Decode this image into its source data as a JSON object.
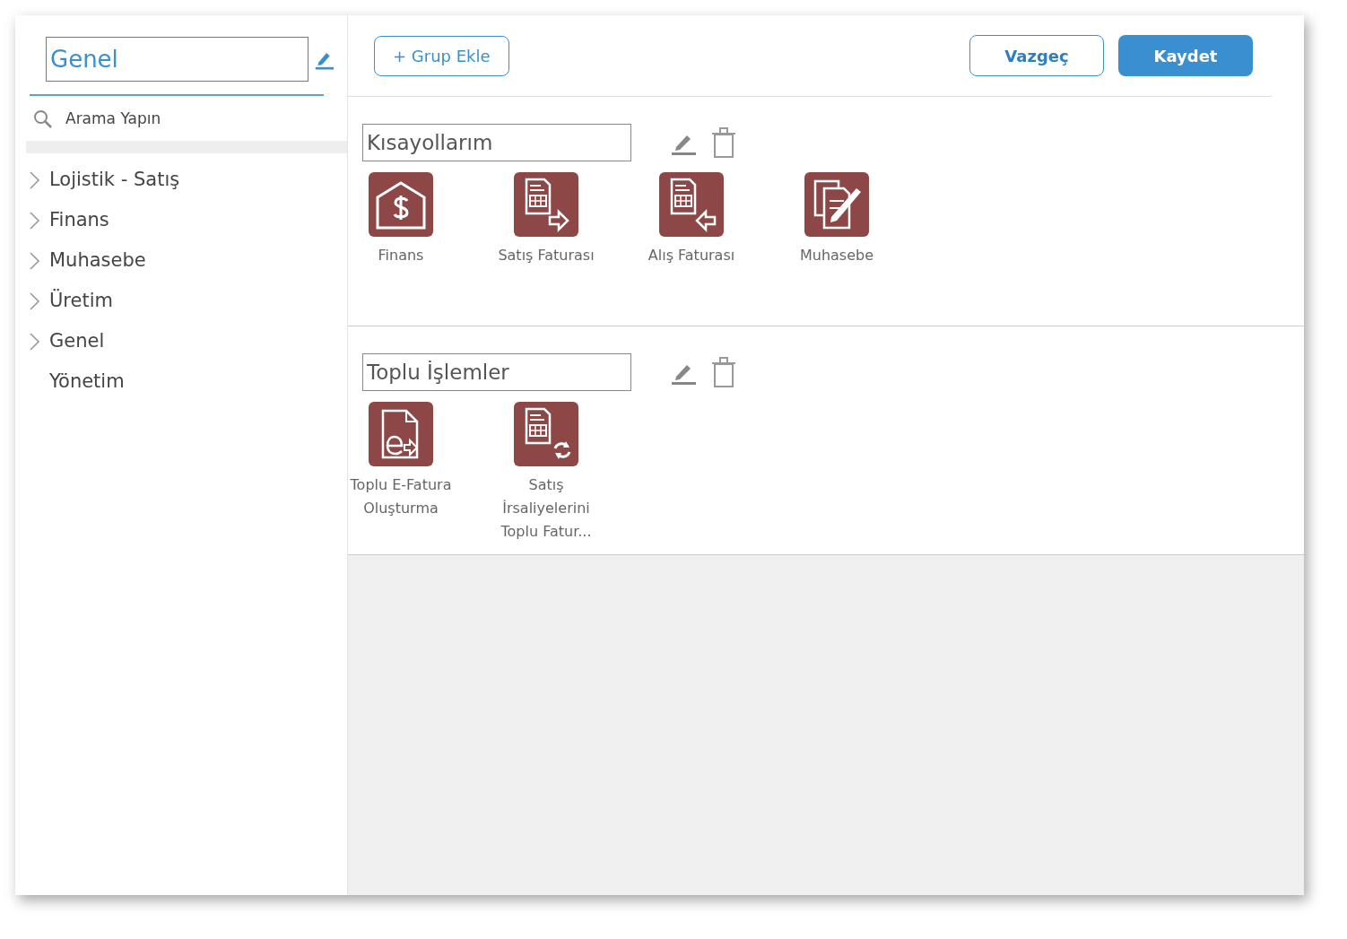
{
  "sidebar": {
    "title": "Genel",
    "search": {
      "placeholder": "Arama Yapın"
    },
    "items": [
      {
        "label": "Lojistik - Satış",
        "expandable": true
      },
      {
        "label": "Finans",
        "expandable": true
      },
      {
        "label": "Muhasebe",
        "expandable": true
      },
      {
        "label": "Üretim",
        "expandable": true
      },
      {
        "label": "Genel",
        "expandable": true
      },
      {
        "label": "Yönetim",
        "expandable": false
      }
    ]
  },
  "toolbar": {
    "add_group": "+ Grup Ekle",
    "cancel": "Vazgeç",
    "save": "Kaydet"
  },
  "groups": [
    {
      "name": "Kısayollarım",
      "shortcuts": [
        {
          "label": "Finans",
          "kind": "finance"
        },
        {
          "label": "Satış Faturası",
          "kind": "sales-invoice"
        },
        {
          "label": "Alış Faturası",
          "kind": "purchase-invoice"
        },
        {
          "label": "Muhasebe",
          "kind": "accounting"
        }
      ]
    },
    {
      "name": "Toplu İşlemler",
      "shortcuts": [
        {
          "label": "Toplu E-Fatura Oluşturma",
          "kind": "e-invoice"
        },
        {
          "label": "Satış İrsaliyelerini Toplu Fatur...",
          "kind": "bulk-invoice"
        }
      ]
    }
  ]
}
